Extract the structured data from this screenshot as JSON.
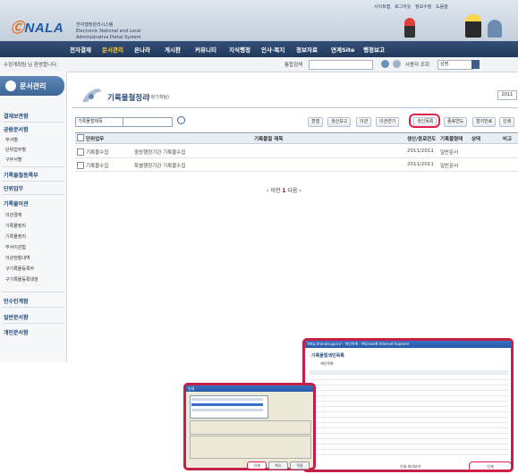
{
  "header": {
    "logo_text": "NALA",
    "logo_mark": "Ⓒ",
    "portal_name_ko": "전자행정관리시스템",
    "portal_name_en": "Electronic National and Local Administrative Portal System",
    "util_links": [
      "사이트맵",
      "로그아웃",
      "정보수정",
      "도움말"
    ]
  },
  "nav": {
    "items": [
      "전자결재",
      "문서관리",
      "온나라",
      "게시판",
      "커뮤니티",
      "지식행정",
      "인사·복지",
      "정보자료",
      "연계Site",
      "행정보고"
    ],
    "active_index": 1
  },
  "subbar": {
    "welcome": "수정게획팀 님 환영합니다.",
    "search_label": "통합검색",
    "user_select_label": "사용자 조회",
    "user_select_value": "성명"
  },
  "left_menu": {
    "title": "문서관리",
    "heads": [
      "결재보관함",
      "공람문서함",
      "기록물철등록부",
      "단위업무",
      "기록물이관",
      "인수인계함",
      "일반문서함",
      "개인문서함"
    ],
    "sub_group1": [
      "부서별",
      "단위업무별",
      "구부서별"
    ],
    "sub_group2": [
      "이관결재",
      "기록물정리",
      "기록물정리",
      "부서이관함",
      "이관현황내역",
      "구기록물등록부",
      "구기록물등록대장"
    ]
  },
  "content": {
    "page_title": "기록물철정리",
    "page_title_sub": "(수정기획팀)",
    "page_select": "2011",
    "filter_select": "기록물철제목",
    "actions": [
      "편철",
      "생산보고",
      "이관",
      "이관연기",
      "색인목록",
      "종료연도",
      "철지만료",
      "인쇄"
    ],
    "columns": [
      "단위업무",
      "기록물철 제목",
      "생산/종료연도",
      "기록물형태",
      "상태",
      "비고"
    ],
    "rows": [
      {
        "unit": "기록물수집",
        "title": "중앙행정기관 기록물수집",
        "years": "2011/2011",
        "form": "일반문서",
        "status": "",
        "note": ""
      },
      {
        "unit": "기록물수집",
        "title": "특별행정기관 기록물수집",
        "years": "2011/2011",
        "form": "일반문서",
        "status": "",
        "note": ""
      }
    ],
    "pager": {
      "prev": "이전",
      "current": "1",
      "next": "다음"
    }
  },
  "popup": {
    "bar_text": "http://ronala.go.kr/ - 색인목록 - Microsoft Internet Explorer",
    "title": "기록물철색인목록",
    "list_label": "색인목록",
    "footer": "인쇄 미리보기",
    "close_button": "인쇄"
  },
  "print_dialog": {
    "title": "인쇄",
    "ok": "인쇄",
    "cancel": "취소",
    "apply": "적용"
  },
  "colors": {
    "nav_bg": "#2a4468",
    "accent": "#e11f4a",
    "menu_title_bg": "#4c76a6",
    "brand": "#1f5aa8"
  }
}
